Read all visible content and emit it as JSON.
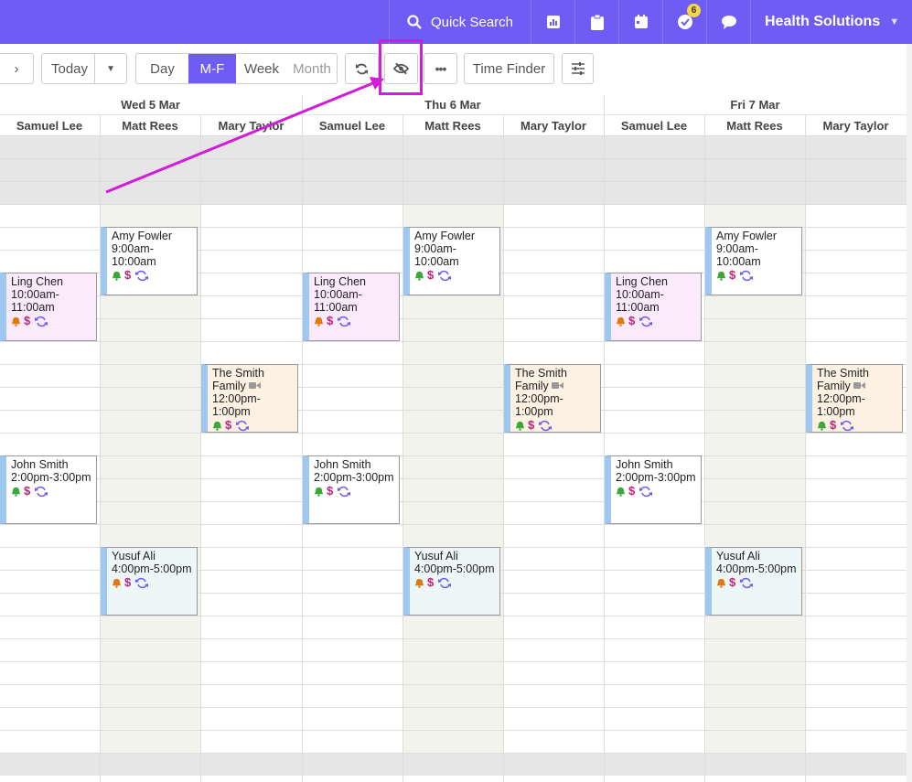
{
  "header": {
    "quick_search": "Quick Search",
    "tasks_badge": "6",
    "org_name": "Health Solutions",
    "brand_color": "#6f5cf4"
  },
  "toolbar": {
    "today": "Today",
    "views": [
      "Day",
      "M-F",
      "Week",
      "Month"
    ],
    "active_view": "M-F",
    "time_finder": "Time Finder"
  },
  "days": [
    "Wed 5 Mar",
    "Thu 6 Mar",
    "Fri 7 Mar"
  ],
  "staff": [
    "Samuel Lee",
    "Matt Rees",
    "Mary Taylor"
  ],
  "appointments": [
    {
      "day": 0,
      "staff": 1,
      "name": "Amy Fowler",
      "time": "9:00am-\n10:00am",
      "bell": "green",
      "color": "#ffffff"
    },
    {
      "day": 1,
      "staff": 1,
      "name": "Amy Fowler",
      "time": "9:00am-\n10:00am",
      "bell": "green",
      "color": "#ffffff"
    },
    {
      "day": 2,
      "staff": 1,
      "name": "Amy Fowler",
      "time": "9:00am-\n10:00am",
      "bell": "green",
      "color": "#ffffff"
    },
    {
      "day": 0,
      "staff": 0,
      "name": "Ling Chen",
      "time": "10:00am-\n11:00am",
      "bell": "orange",
      "color": "#fbeafb"
    },
    {
      "day": 1,
      "staff": 0,
      "name": "Ling Chen",
      "time": "10:00am-\n11:00am",
      "bell": "orange",
      "color": "#fbeafb"
    },
    {
      "day": 2,
      "staff": 0,
      "name": "Ling Chen",
      "time": "10:00am-\n11:00am",
      "bell": "orange",
      "color": "#fbeafb"
    },
    {
      "day": 0,
      "staff": 2,
      "name": "The Smith\nFamily",
      "time": "12:00pm-\n1:00pm",
      "bell": "green",
      "video": true,
      "color": "#fdf1e4"
    },
    {
      "day": 1,
      "staff": 2,
      "name": "The Smith\nFamily",
      "time": "12:00pm-\n1:00pm",
      "bell": "green",
      "video": true,
      "color": "#fdf1e4"
    },
    {
      "day": 2,
      "staff": 2,
      "name": "The Smith\nFamily",
      "time": "12:00pm-\n1:00pm",
      "bell": "green",
      "video": true,
      "color": "#fdf1e4"
    },
    {
      "day": 0,
      "staff": 0,
      "name": "John Smith",
      "time": "2:00pm-3:00pm",
      "bell": "green",
      "color": "#ffffff"
    },
    {
      "day": 1,
      "staff": 0,
      "name": "John Smith",
      "time": "2:00pm-3:00pm",
      "bell": "green",
      "color": "#ffffff"
    },
    {
      "day": 2,
      "staff": 0,
      "name": "John Smith",
      "time": "2:00pm-3:00pm",
      "bell": "green",
      "color": "#ffffff"
    },
    {
      "day": 0,
      "staff": 1,
      "name": "Yusuf Ali",
      "time": "4:00pm-5:00pm",
      "bell": "orange",
      "color": "#eef7f8"
    },
    {
      "day": 1,
      "staff": 1,
      "name": "Yusuf Ali",
      "time": "4:00pm-5:00pm",
      "bell": "orange",
      "color": "#eef7f8"
    },
    {
      "day": 2,
      "staff": 1,
      "name": "Yusuf Ali",
      "time": "4:00pm-5:00pm",
      "bell": "orange",
      "color": "#eef7f8"
    }
  ]
}
